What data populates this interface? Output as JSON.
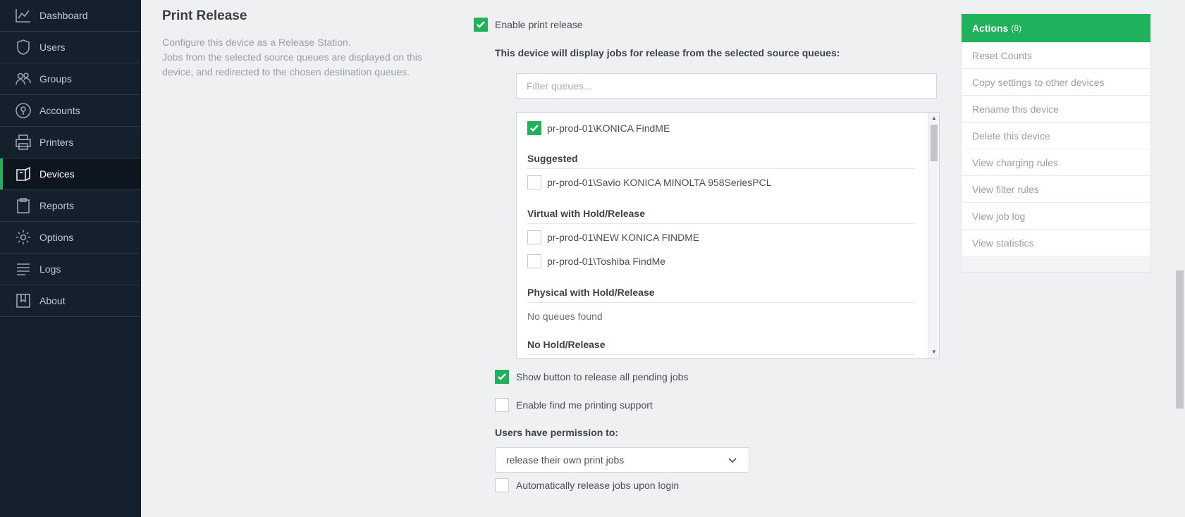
{
  "sidebar": {
    "items": [
      {
        "label": "Dashboard",
        "icon": "dashboard-icon"
      },
      {
        "label": "Users",
        "icon": "users-icon"
      },
      {
        "label": "Groups",
        "icon": "groups-icon"
      },
      {
        "label": "Accounts",
        "icon": "accounts-icon"
      },
      {
        "label": "Printers",
        "icon": "printer-icon"
      },
      {
        "label": "Devices",
        "icon": "devices-icon",
        "active": true
      },
      {
        "label": "Reports",
        "icon": "reports-icon"
      },
      {
        "label": "Options",
        "icon": "gear-icon"
      },
      {
        "label": "Logs",
        "icon": "logs-icon"
      },
      {
        "label": "About",
        "icon": "about-icon"
      }
    ]
  },
  "section": {
    "title": "Print Release",
    "description": "Configure this device as a Release Station.\nJobs from the selected source queues are displayed on this device, and redirected to the chosen destination queues."
  },
  "form": {
    "enable_print_release": {
      "label": "Enable print release",
      "checked": true
    },
    "source_queues_label": "This device will display jobs for release from the selected source queues:",
    "filter_placeholder": "Filter queues...",
    "queues": {
      "selected": [
        {
          "label": "pr-prod-01\\KONICA FindME",
          "checked": true
        }
      ],
      "groups": [
        {
          "title": "Suggested",
          "items": [
            {
              "label": "pr-prod-01\\Savio KONICA MINOLTA 958SeriesPCL",
              "checked": false
            }
          ]
        },
        {
          "title": "Virtual with Hold/Release",
          "items": [
            {
              "label": "pr-prod-01\\NEW KONICA FINDME",
              "checked": false
            },
            {
              "label": "pr-prod-01\\Toshiba FindMe",
              "checked": false
            }
          ]
        },
        {
          "title": "Physical with Hold/Release",
          "empty_text": "No queues found"
        },
        {
          "title": "No Hold/Release"
        }
      ]
    },
    "show_release_all": {
      "label": "Show button to release all pending jobs",
      "checked": true
    },
    "find_me": {
      "label": "Enable find me printing support",
      "checked": false
    },
    "permission_label": "Users have permission to:",
    "permission_value": "release their own print jobs",
    "auto_release": {
      "label": "Automatically release jobs upon login",
      "checked": false
    }
  },
  "actions": {
    "title": "Actions",
    "count": "(8)",
    "items": [
      "Reset Counts",
      "Copy settings to other devices",
      "Rename this device",
      "Delete this device",
      "View charging rules",
      "View filter rules",
      "View job log",
      "View statistics"
    ]
  },
  "colors": {
    "accent": "#1fb15b",
    "sidebar": "#14212d",
    "background": "#eef0f2"
  }
}
